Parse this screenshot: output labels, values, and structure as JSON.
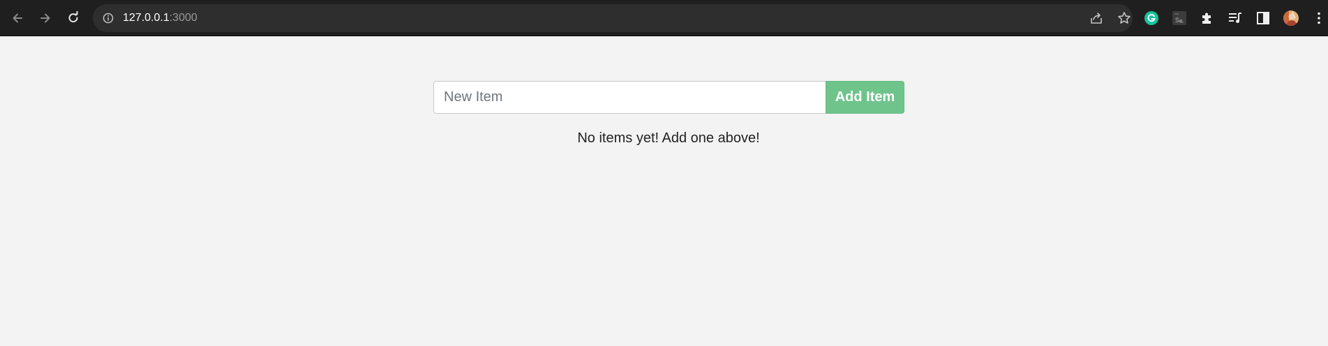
{
  "browser": {
    "url_host": "127.0.0.1",
    "url_port": ":3000"
  },
  "form": {
    "input_placeholder": "New Item",
    "input_value": "",
    "add_button_label": "Add Item"
  },
  "list": {
    "empty_message": "No items yet! Add one above!"
  },
  "colors": {
    "add_button": "#6ec48b",
    "page_background": "#f3f3f3",
    "chrome_background": "#1f1f1f",
    "grammarly": "#15c39a"
  },
  "icons": {
    "back": "arrow-left-icon",
    "forward": "arrow-right-icon",
    "reload": "reload-icon",
    "site_info": "info-icon",
    "share": "share-icon",
    "bookmark": "star-icon",
    "extensions": [
      "grammarly-icon",
      "selenium-icon",
      "puzzle-icon",
      "media-queue-icon",
      "side-panel-icon",
      "profile-avatar-icon",
      "kebab-menu-icon"
    ]
  }
}
